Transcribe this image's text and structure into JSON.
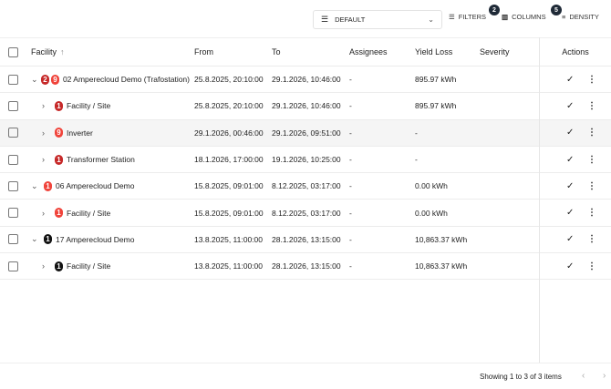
{
  "toolbar": {
    "view": "DEFAULT",
    "filters": "FILTERS",
    "filters_count": "2",
    "columns": "COLUMNS",
    "columns_count": "5",
    "density": "DENSITY"
  },
  "columns": [
    "Facility",
    "From",
    "To",
    "Assignees",
    "Yield Loss",
    "Severity",
    "Actions"
  ],
  "colors": {
    "badge_dark_red": "#c62828",
    "badge_red": "#f0433a",
    "badge_black": "#111111"
  },
  "rows": [
    {
      "level": 0,
      "expanded": true,
      "badges": [
        {
          "n": "2",
          "c": "#c62828"
        },
        {
          "n": "9",
          "c": "#f0433a"
        }
      ],
      "facility": "02 Amperecloud Demo (Trafostation)",
      "from": "25.8.2025, 20:10:00",
      "to": "29.1.2026, 10:46:00",
      "assignees": "-",
      "yield": "895.97 kWh",
      "severity": ""
    },
    {
      "level": 1,
      "expanded": false,
      "badges": [
        {
          "n": "1",
          "c": "#c62828"
        }
      ],
      "facility": "Facility / Site",
      "from": "25.8.2025, 20:10:00",
      "to": "29.1.2026, 10:46:00",
      "assignees": "-",
      "yield": "895.97 kWh",
      "severity": ""
    },
    {
      "level": 1,
      "expanded": false,
      "badges": [
        {
          "n": "9",
          "c": "#f0433a"
        }
      ],
      "facility": "Inverter",
      "from": "29.1.2026, 00:46:00",
      "to": "29.1.2026, 09:51:00",
      "assignees": "-",
      "yield": "-",
      "severity": ""
    },
    {
      "level": 1,
      "expanded": false,
      "badges": [
        {
          "n": "1",
          "c": "#c62828"
        }
      ],
      "facility": "Transformer Station",
      "from": "18.1.2026, 17:00:00",
      "to": "19.1.2026, 10:25:00",
      "assignees": "-",
      "yield": "-",
      "severity": ""
    },
    {
      "level": 0,
      "expanded": true,
      "badges": [
        {
          "n": "1",
          "c": "#f0433a"
        }
      ],
      "facility": "06 Amperecloud Demo",
      "from": "15.8.2025, 09:01:00",
      "to": "8.12.2025, 03:17:00",
      "assignees": "-",
      "yield": "0.00 kWh",
      "severity": ""
    },
    {
      "level": 1,
      "expanded": false,
      "badges": [
        {
          "n": "1",
          "c": "#f0433a"
        }
      ],
      "facility": "Facility / Site",
      "from": "15.8.2025, 09:01:00",
      "to": "8.12.2025, 03:17:00",
      "assignees": "-",
      "yield": "0.00 kWh",
      "severity": ""
    },
    {
      "level": 0,
      "expanded": true,
      "badges": [
        {
          "n": "1",
          "c": "#111111"
        }
      ],
      "facility": "17 Amperecloud Demo",
      "from": "13.8.2025, 11:00:00",
      "to": "28.1.2026, 13:15:00",
      "assignees": "-",
      "yield": "10,863.37 kWh",
      "severity": ""
    },
    {
      "level": 1,
      "expanded": false,
      "badges": [
        {
          "n": "1",
          "c": "#111111"
        }
      ],
      "facility": "Facility / Site",
      "from": "13.8.2025, 11:00:00",
      "to": "28.1.2026, 13:15:00",
      "assignees": "-",
      "yield": "10,863.37 kWh",
      "severity": ""
    }
  ],
  "footer": {
    "showing": "Showing 1 to 3 of 3 items"
  }
}
